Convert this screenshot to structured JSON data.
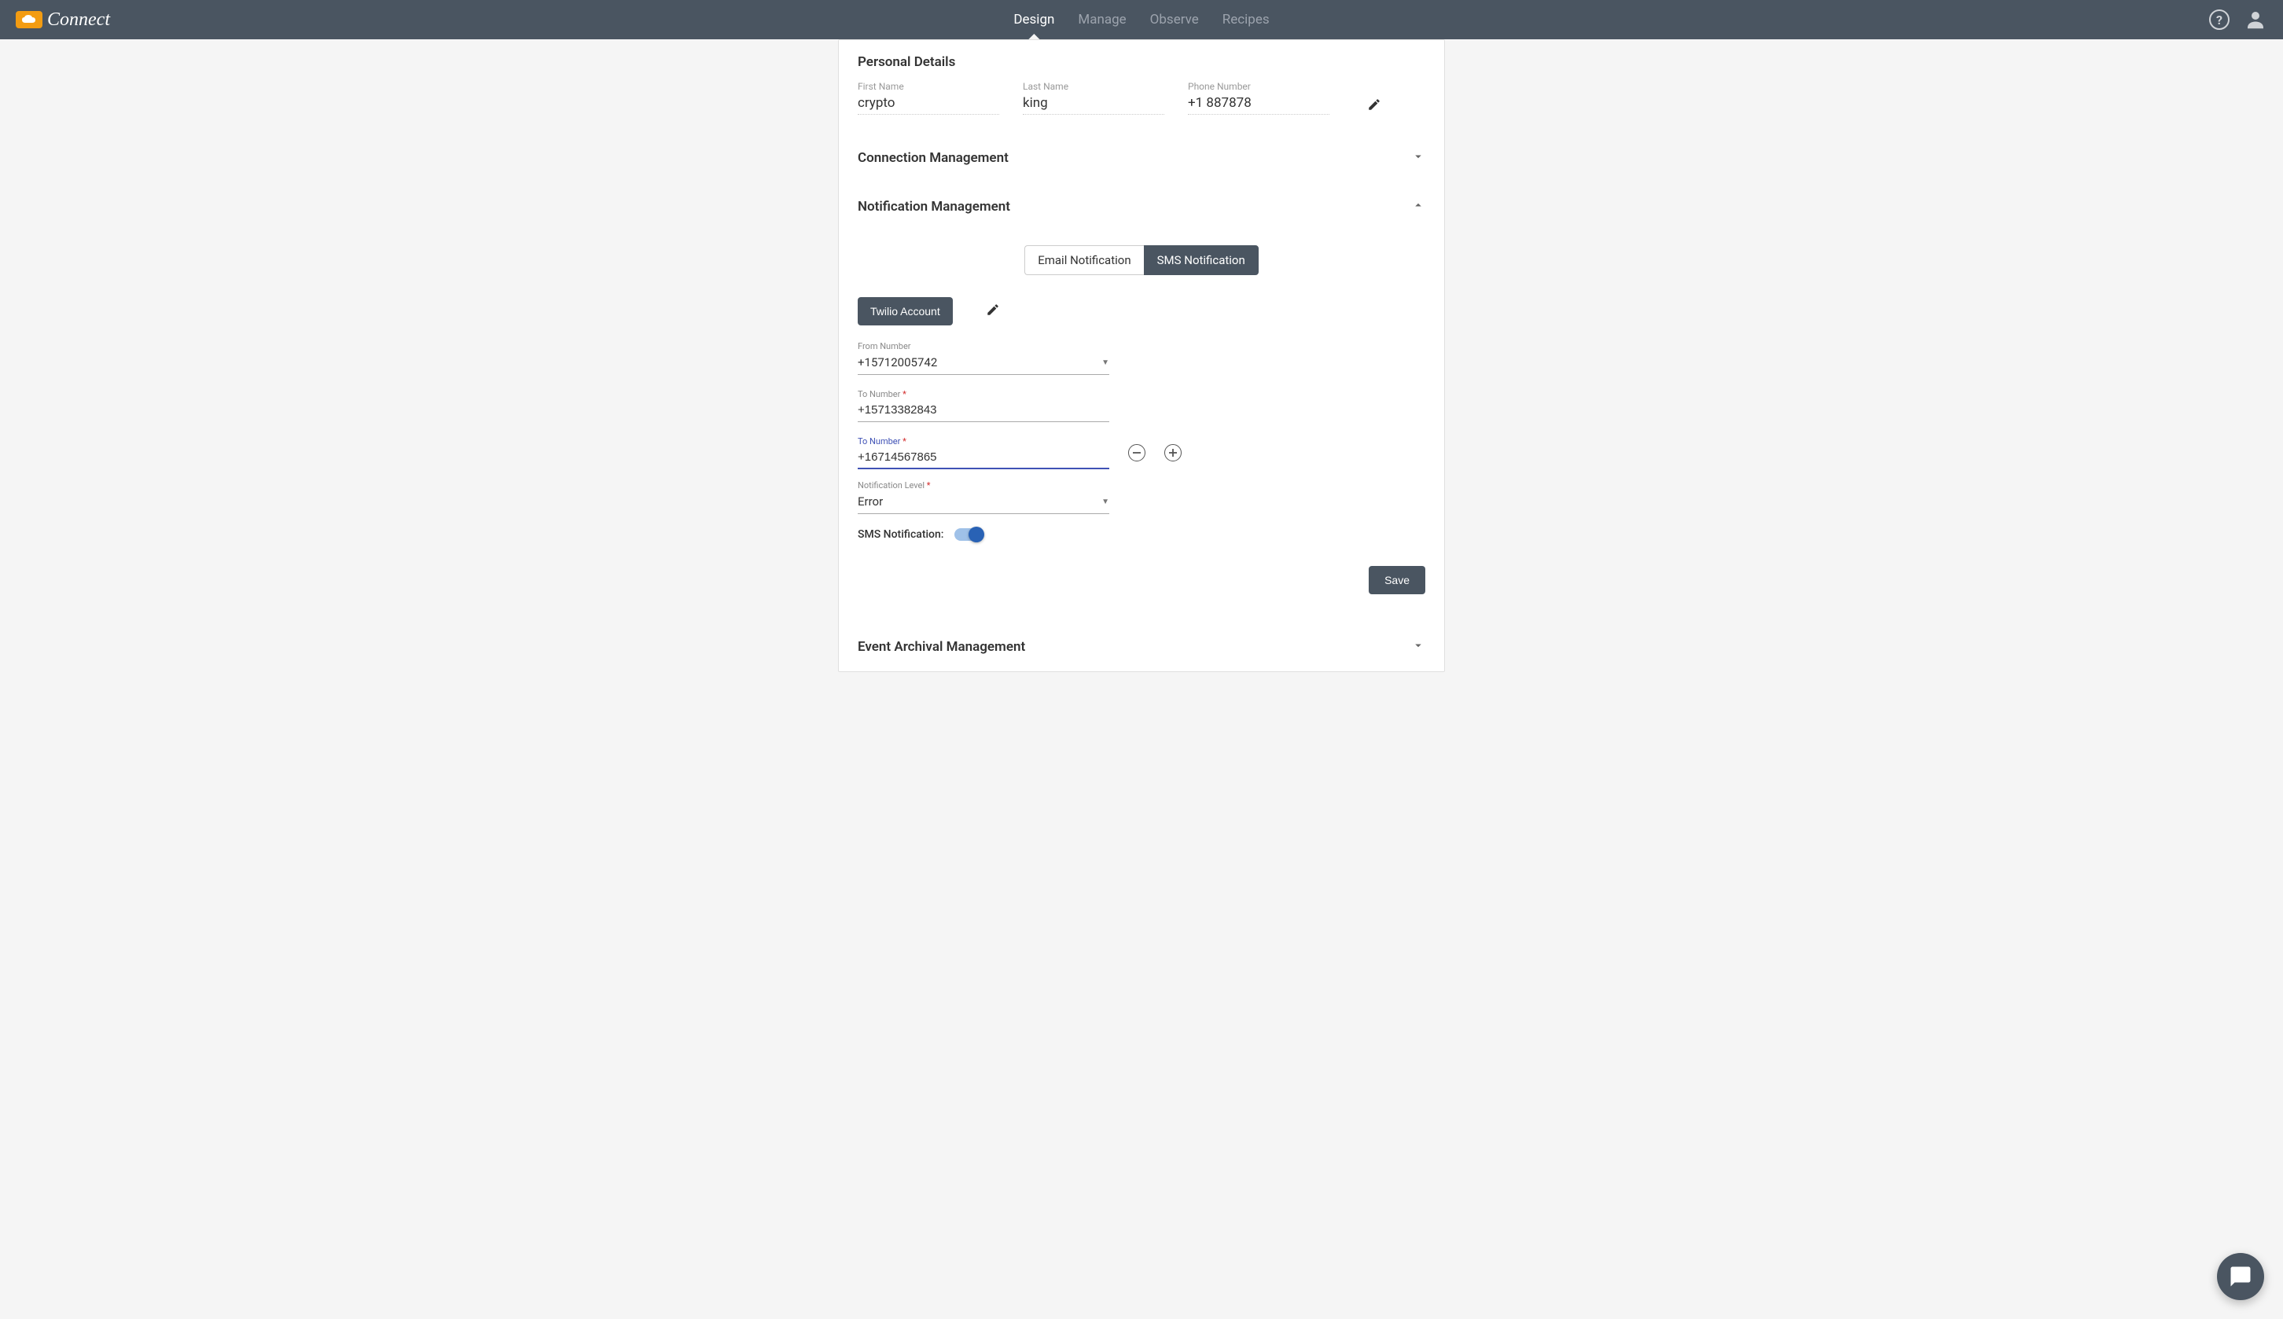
{
  "header": {
    "brand": "Connect",
    "nav": {
      "design": "Design",
      "manage": "Manage",
      "observe": "Observe",
      "recipes": "Recipes"
    }
  },
  "sections": {
    "personal_details": {
      "title": "Personal Details",
      "first_name_label": "First Name",
      "first_name_value": "crypto",
      "last_name_label": "Last Name",
      "last_name_value": "king",
      "phone_label": "Phone Number",
      "phone_value": "+1 887878"
    },
    "connection_management": {
      "title": "Connection Management"
    },
    "notification_management": {
      "title": "Notification Management",
      "tabs": {
        "email": "Email Notification",
        "sms": "SMS Notification"
      },
      "twilio_button": "Twilio Account",
      "from_number_label": "From Number",
      "from_number_value": "+15712005742",
      "to_number_label": "To Number",
      "to_number_1_value": "+15713382843",
      "to_number_2_value": "+16714567865",
      "notification_level_label": "Notification Level",
      "notification_level_value": "Error",
      "sms_toggle_label": "SMS Notification:",
      "save_button": "Save"
    },
    "event_archival": {
      "title": "Event Archival Management"
    }
  },
  "required_marker": "*"
}
